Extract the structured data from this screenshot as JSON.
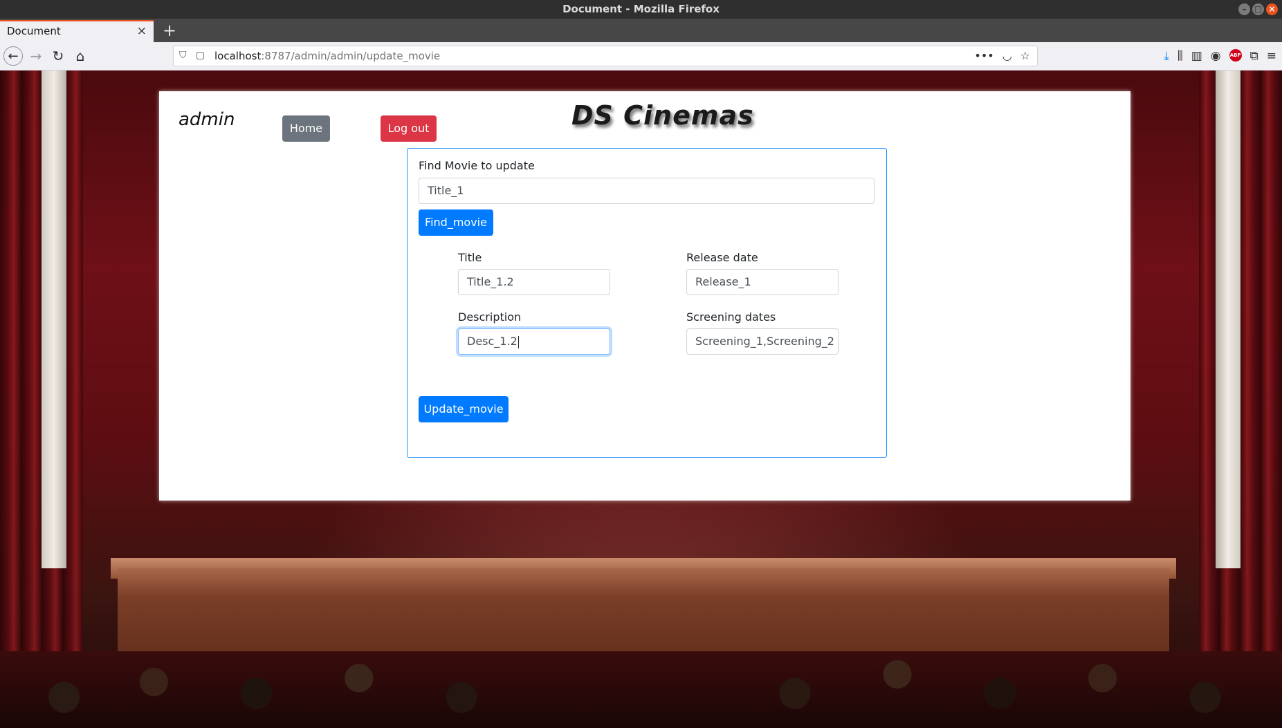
{
  "window": {
    "title": "Document - Mozilla Firefox"
  },
  "tab": {
    "title": "Document",
    "close": "×",
    "new_tab": "+"
  },
  "toolbar": {
    "url_host": "localhost",
    "url_rest": ":8787/admin/admin/update_movie",
    "icons": [
      "back-icon",
      "forward-icon",
      "reload-icon",
      "home-icon",
      "shield-icon",
      "page-icon",
      "more-icon",
      "pocket-icon",
      "bookmark-star-icon",
      "download-icon",
      "library-icon",
      "sidebar-icon",
      "account-icon",
      "adblock-icon",
      "extensions-icon",
      "menu-icon"
    ],
    "abp_label": "ABP"
  },
  "header": {
    "user": "admin",
    "home_label": "Home",
    "logout_label": "Log out",
    "brand": "DS Cinemas"
  },
  "find": {
    "label": "Find Movie to update",
    "value": "Title_1",
    "button": "Find_movie"
  },
  "form": {
    "title_label": "Title",
    "title_value": "Title_1.2",
    "release_label": "Release date",
    "release_value": "Release_1",
    "description_label": "Description",
    "description_value": "Desc_1.2",
    "screening_label": "Screening dates",
    "screening_value": "Screening_1,Screening_2",
    "update_button": "Update_movie"
  },
  "colors": {
    "primary": "#007bff",
    "secondary": "#6c757d",
    "danger": "#dc3545",
    "card_border": "#1e90ff",
    "firefox_accent": "#e95420"
  }
}
